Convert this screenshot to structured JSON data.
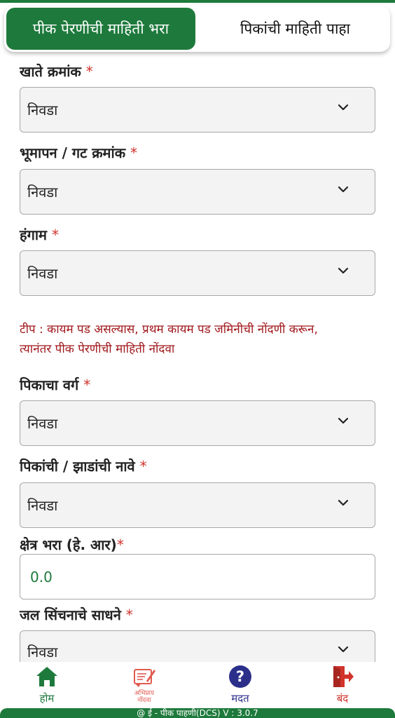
{
  "tabs": {
    "active_label": "पीक पेरणीची माहिती भरा",
    "inactive_label": "पिकांची माहिती पाहा"
  },
  "fields": {
    "khate": {
      "label": "खाते क्रमांक",
      "required": "*",
      "value": "निवडा"
    },
    "bhumapan": {
      "label": "भूमापन / गट क्रमांक",
      "required": "*",
      "value": "निवडा"
    },
    "hangam": {
      "label": "हंगाम",
      "required": "*",
      "value": "निवडा"
    },
    "pikacha_varg": {
      "label": "पिकाचा वर्ग",
      "required": "*",
      "value": "निवडा"
    },
    "pik_nave": {
      "label": "पिकांची / झाडांची नावे",
      "required": "*",
      "value": "निवडा"
    },
    "kshetra": {
      "label": "क्षेत्र भरा (हे. आर)",
      "required": "*",
      "value": "0.0"
    },
    "jal_sinchan": {
      "label": "जल सिंचनाचे साधने",
      "required": "*",
      "value": "निवडा"
    }
  },
  "note": {
    "line1": "टीप : कायम पड असल्यास, प्रथम कायम पड जमिनीची नोंदणी करून,",
    "line2": "त्यानंतर पीक पेरणीची माहिती नोंदवा"
  },
  "bottom_nav": {
    "home": {
      "label": "होम",
      "icon": "home-icon",
      "color": "#1e7a3c"
    },
    "feedback": {
      "label_line1": "अभिप्राय",
      "label_line2": "नोंदवा",
      "icon": "feedback-icon",
      "color": "#e05a4f"
    },
    "help": {
      "label": "मदत",
      "icon": "help-icon",
      "color": "#2b2f8a"
    },
    "close": {
      "label": "बंद",
      "icon": "exit-icon",
      "color": "#d0342c"
    }
  },
  "footer": {
    "text": "@ ई - पीक पाहणी(DCS) V : 3.0.7"
  },
  "colors": {
    "brand_green": "#1e7a3c",
    "required_red": "#d0342c",
    "note_red": "#a0181c"
  }
}
